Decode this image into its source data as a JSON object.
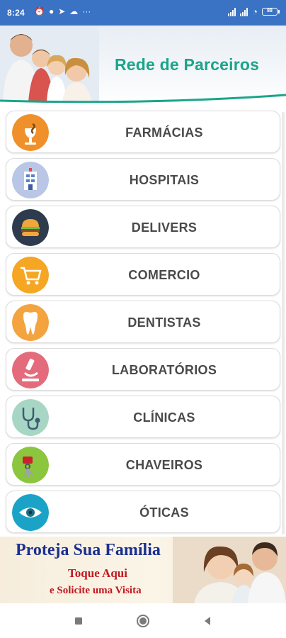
{
  "status_bar": {
    "time": "8:24",
    "notification_icons": [
      "alarm-icon",
      "chat-icon",
      "telegram-icon",
      "cloud-icon"
    ],
    "more": "···",
    "battery": "88"
  },
  "header": {
    "title": "Rede de Parceiros"
  },
  "categories": [
    {
      "label": "FARMÁCIAS",
      "icon": "pharmacy-icon",
      "color": "#f0902b"
    },
    {
      "label": "HOSPITAIS",
      "icon": "hospital-icon",
      "color": "#b9c6e6"
    },
    {
      "label": "DELIVERS",
      "icon": "burger-icon",
      "color": "#2e3b4d"
    },
    {
      "label": "COMERCIO",
      "icon": "cart-icon",
      "color": "#f5a623"
    },
    {
      "label": "DENTISTAS",
      "icon": "tooth-icon",
      "color": "#f3a43e"
    },
    {
      "label": "LABORATÓRIOS",
      "icon": "microscope-icon",
      "color": "#e46b7c"
    },
    {
      "label": "CLÍNICAS",
      "icon": "stethoscope-icon",
      "color": "#a7d6c5"
    },
    {
      "label": "CHAVEIROS",
      "icon": "keys-icon",
      "color": "#8cc63f"
    },
    {
      "label": "ÓTICAS",
      "icon": "eye-icon",
      "color": "#1aa3c6"
    }
  ],
  "ad_banner": {
    "title": "Proteja Sua Família",
    "subtitle": "Toque Aqui",
    "subtitle2": "e Solicite uma Visita"
  },
  "colors": {
    "status_bar": "#3a72c4",
    "header_title": "#1aa58a",
    "ad_title": "#1c2f8f",
    "ad_sub": "#c0181f",
    "item_text": "#4a4a4a"
  }
}
